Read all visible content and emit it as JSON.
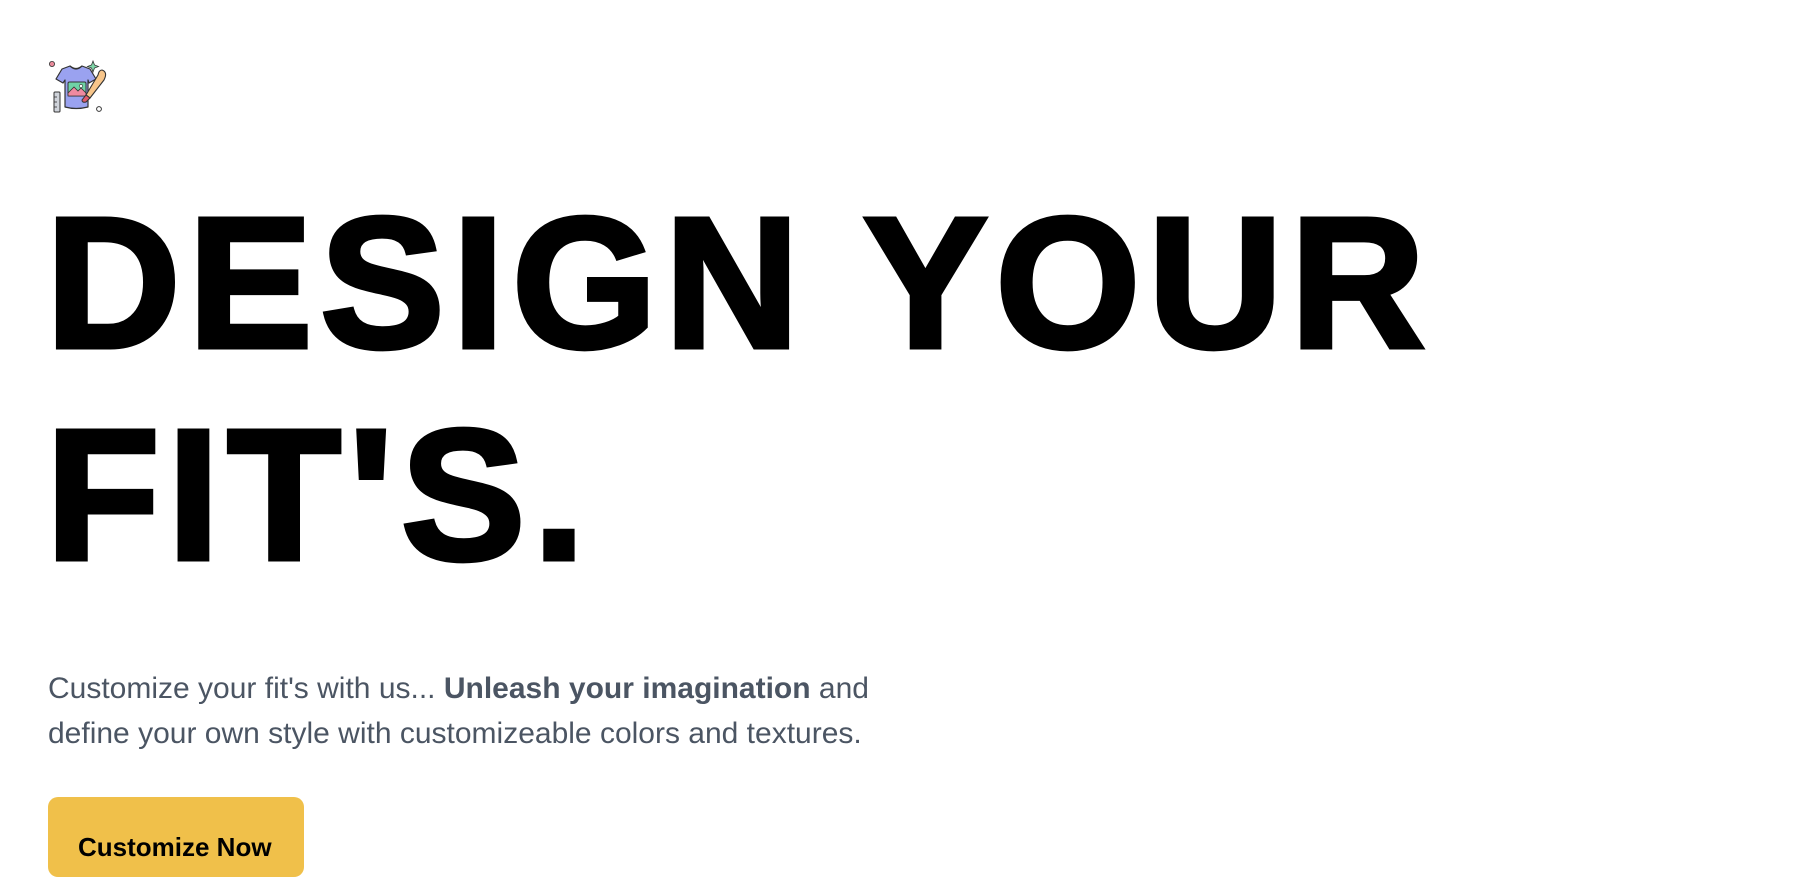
{
  "brand": {
    "logo_icon": "tshirt-paintbrush-icon",
    "accent_color": "#f0c04a"
  },
  "hero": {
    "title_line_1": "DESIGN YOUR",
    "title_line_2": "FIT'S.",
    "tagline_start": "Customize your fit's with us... ",
    "tagline_bold": "Unleash your imagination",
    "tagline_end": " and define your own style with customizeable colors and textures.",
    "cta_label": "Customize Now"
  }
}
